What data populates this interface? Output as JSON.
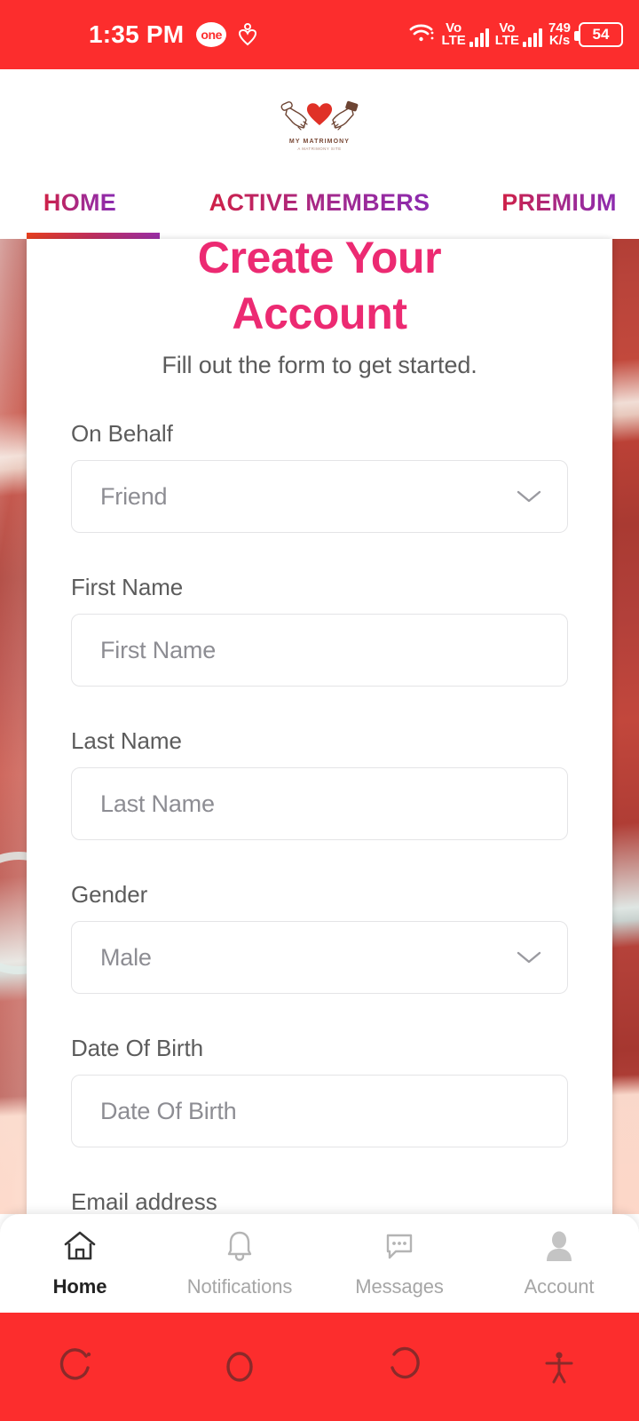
{
  "status_bar": {
    "time": "1:35 PM",
    "carrier_badge": "one",
    "heart_icon": "heart-icon",
    "wifi_icon": "wifi-icon",
    "sim1_network": "Vo\nLTE",
    "sim1_network_line1": "Vo",
    "sim1_network_line2": "LTE",
    "sim2_network_line1": "Vo",
    "sim2_network_line2": "LTE",
    "network_speed_value": "749",
    "network_speed_unit": "K/s",
    "battery_level": "54",
    "background_color": "#fc2d2d"
  },
  "header": {
    "logo_name": "MY MATRIMONY",
    "logo_tagline": "A MATRIMONY SITE",
    "logo_icon": "couple-heart-logo"
  },
  "tabs": {
    "items": [
      {
        "label": "HOME",
        "active": true
      },
      {
        "label": "ACTIVE MEMBERS",
        "active": false
      },
      {
        "label": "PREMIUM",
        "active": false
      }
    ],
    "gradient_start": "#e8401f",
    "gradient_end": "#9b2fa8"
  },
  "form": {
    "title_line1": "Create Your",
    "title_line2": "Account",
    "title_color": "#ec2a72",
    "subtitle": "Fill out the form to get started.",
    "fields": [
      {
        "label": "On Behalf",
        "value": "Friend",
        "type": "select",
        "name": "on-behalf"
      },
      {
        "label": "First Name",
        "value": "First Name",
        "type": "text",
        "name": "first-name"
      },
      {
        "label": "Last Name",
        "value": "Last Name",
        "type": "text",
        "name": "last-name"
      },
      {
        "label": "Gender",
        "value": "Male",
        "type": "select",
        "name": "gender"
      },
      {
        "label": "Date Of Birth",
        "value": "Date Of Birth",
        "type": "text",
        "name": "date-of-birth"
      }
    ],
    "next_field_label": "Email address"
  },
  "bottom_nav": {
    "items": [
      {
        "label": "Home",
        "icon": "home-icon",
        "active": true
      },
      {
        "label": "Notifications",
        "icon": "bell-icon",
        "active": false
      },
      {
        "label": "Messages",
        "icon": "message-icon",
        "active": false
      },
      {
        "label": "Account",
        "icon": "person-icon",
        "active": false
      }
    ]
  },
  "system_nav": {
    "background_color": "#fc2d2d",
    "buttons": [
      {
        "name": "recents-icon"
      },
      {
        "name": "home-circle-icon"
      },
      {
        "name": "back-icon"
      },
      {
        "name": "accessibility-icon"
      }
    ]
  }
}
